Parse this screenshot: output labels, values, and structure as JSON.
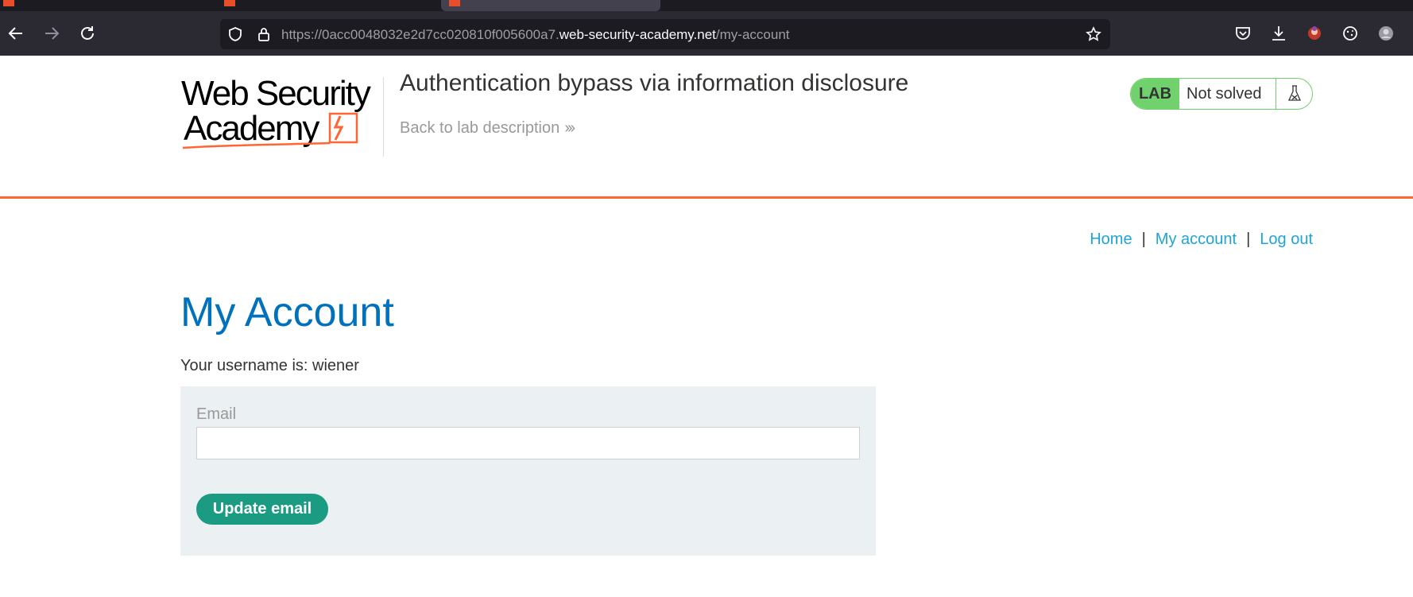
{
  "browser": {
    "url_prefix": "https://0acc0048032e2d7cc020810f005600a7.",
    "url_host": "web-security-academy.net",
    "url_path": "/my-account"
  },
  "header": {
    "logo_alt": "Web Security Academy",
    "lab_title": "Authentication bypass via information disclosure",
    "back_link": "Back to lab description",
    "lab_badge": "LAB",
    "lab_state": "Not solved"
  },
  "nav": {
    "home": "Home",
    "sep": "|",
    "my_account": "My account",
    "log_out": "Log out"
  },
  "main": {
    "heading": "My Account",
    "username_text": "Your username is: wiener",
    "email_label": "Email",
    "email_value": "",
    "update_button": "Update email"
  },
  "colors": {
    "accent_orange": "#ff6633",
    "heading_blue": "#0071bc",
    "link_blue": "#1fa3d9",
    "button_green": "#1b9c82",
    "lab_green": "#70d16d"
  },
  "icons": [
    "back-icon",
    "forward-icon",
    "reload-icon",
    "shield-icon",
    "lock-icon",
    "star-icon",
    "pocket-icon",
    "download-icon",
    "extension-avatar-icon",
    "cookie-icon",
    "account-icon",
    "flask-icon",
    "chevron-double-right-icon"
  ]
}
